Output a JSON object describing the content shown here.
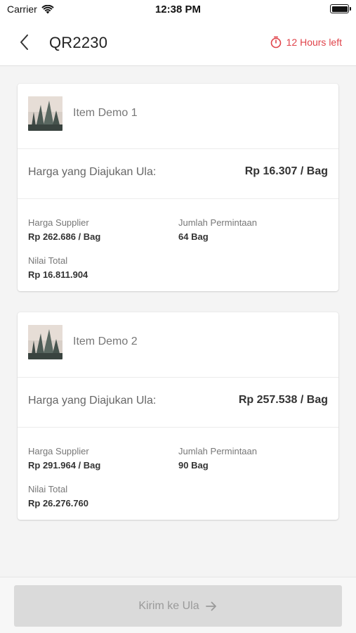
{
  "status_bar": {
    "carrier": "Carrier",
    "time": "12:38 PM"
  },
  "header": {
    "title": "QR2230",
    "timer_text": "12 Hours left"
  },
  "items": [
    {
      "name": "Item Demo 1",
      "price_label": "Harga yang Diajukan Ula:",
      "price_value": "Rp 16.307 / Bag",
      "supplier_label": "Harga Supplier",
      "supplier_value": "Rp 262.686 / Bag",
      "qty_label": "Jumlah Permintaan",
      "qty_value": "64 Bag",
      "total_label": "Nilai Total",
      "total_value": "Rp 16.811.904"
    },
    {
      "name": "Item Demo 2",
      "price_label": "Harga yang Diajukan Ula:",
      "price_value": "Rp 257.538 / Bag",
      "supplier_label": "Harga Supplier",
      "supplier_value": "Rp 291.964 / Bag",
      "qty_label": "Jumlah Permintaan",
      "qty_value": "90 Bag",
      "total_label": "Nilai Total",
      "total_value": "Rp 26.276.760"
    }
  ],
  "footer": {
    "submit_label": "Kirim ke Ula",
    "submit_icon": "arrow-right-icon"
  },
  "colors": {
    "accent_red": "#e0434a",
    "disabled_button": "#dadada",
    "background": "#f4f4f4"
  }
}
